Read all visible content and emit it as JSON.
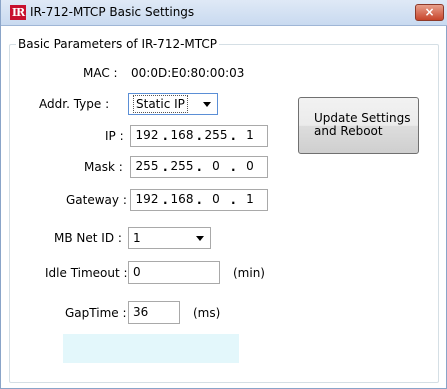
{
  "window": {
    "title": "IR-712-MTCP Basic Settings",
    "icon_text": "IR",
    "close_glyph": "×"
  },
  "group": {
    "title": "Basic Parameters of IR-712-MTCP"
  },
  "mac": {
    "label": "MAC :",
    "value": "00:0D:E0:80:00:03"
  },
  "addr_type": {
    "label": "Addr. Type :",
    "selected": "Static IP"
  },
  "ip": {
    "label": "IP :",
    "octets": [
      "192",
      "168",
      "255",
      "1"
    ]
  },
  "mask": {
    "label": "Mask :",
    "octets": [
      "255",
      "255",
      "0",
      "0"
    ]
  },
  "gateway": {
    "label": "Gateway :",
    "octets": [
      "192",
      "168",
      "0",
      "1"
    ]
  },
  "mb_net_id": {
    "label": "MB Net ID :",
    "selected": "1"
  },
  "idle_timeout": {
    "label": "Idle Timeout :",
    "value": "0",
    "unit": "(min)"
  },
  "gap_time": {
    "label": "GapTime :",
    "value": "36",
    "unit": "(ms)"
  },
  "update_button": {
    "line1": "Update Settings",
    "line2": "and Reboot"
  },
  "ip_separator": ".",
  "colors": {
    "titlebar": "#c9daf0",
    "close_button": "#c7452b",
    "status_area": "#e3f7fb",
    "icon_red": "#c8102e"
  }
}
